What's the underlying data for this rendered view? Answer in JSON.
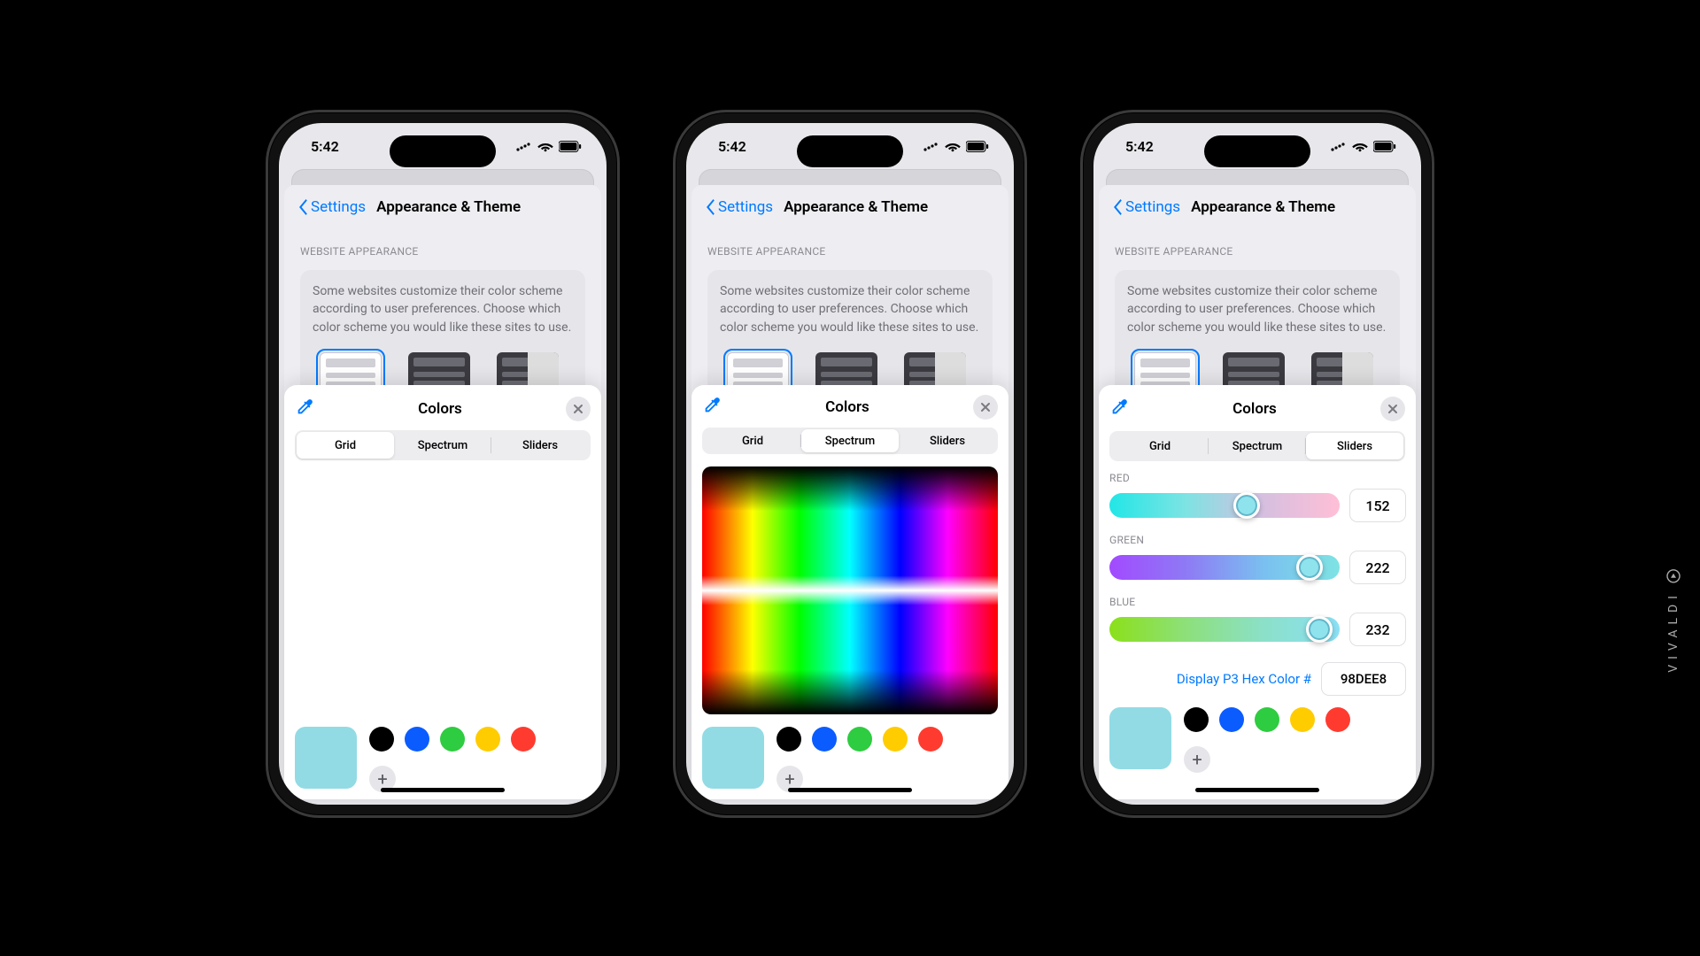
{
  "status": {
    "time": "5:42"
  },
  "nav": {
    "back": "Settings",
    "title": "Appearance & Theme"
  },
  "section": {
    "header": "WEBSITE APPEARANCE",
    "blurb": "Some websites customize their color scheme according to user preferences. Choose which color scheme you would like these sites to use."
  },
  "picker": {
    "title": "Colors",
    "tabs": {
      "grid": "Grid",
      "spectrum": "Spectrum",
      "sliders": "Sliders"
    }
  },
  "swatches": {
    "selected": "#92dbe5",
    "presets": [
      "#000000",
      "#0b5cff",
      "#2ecc40",
      "#ffcc00",
      "#ff3b30"
    ]
  },
  "sliders": {
    "red": {
      "label": "RED",
      "value": 152
    },
    "green": {
      "label": "GREEN",
      "value": 222
    },
    "blue": {
      "label": "BLUE",
      "value": 232
    },
    "hex": {
      "label": "Display P3 Hex Color #",
      "value": "98DEE8"
    }
  },
  "brand": "VIVALDI"
}
